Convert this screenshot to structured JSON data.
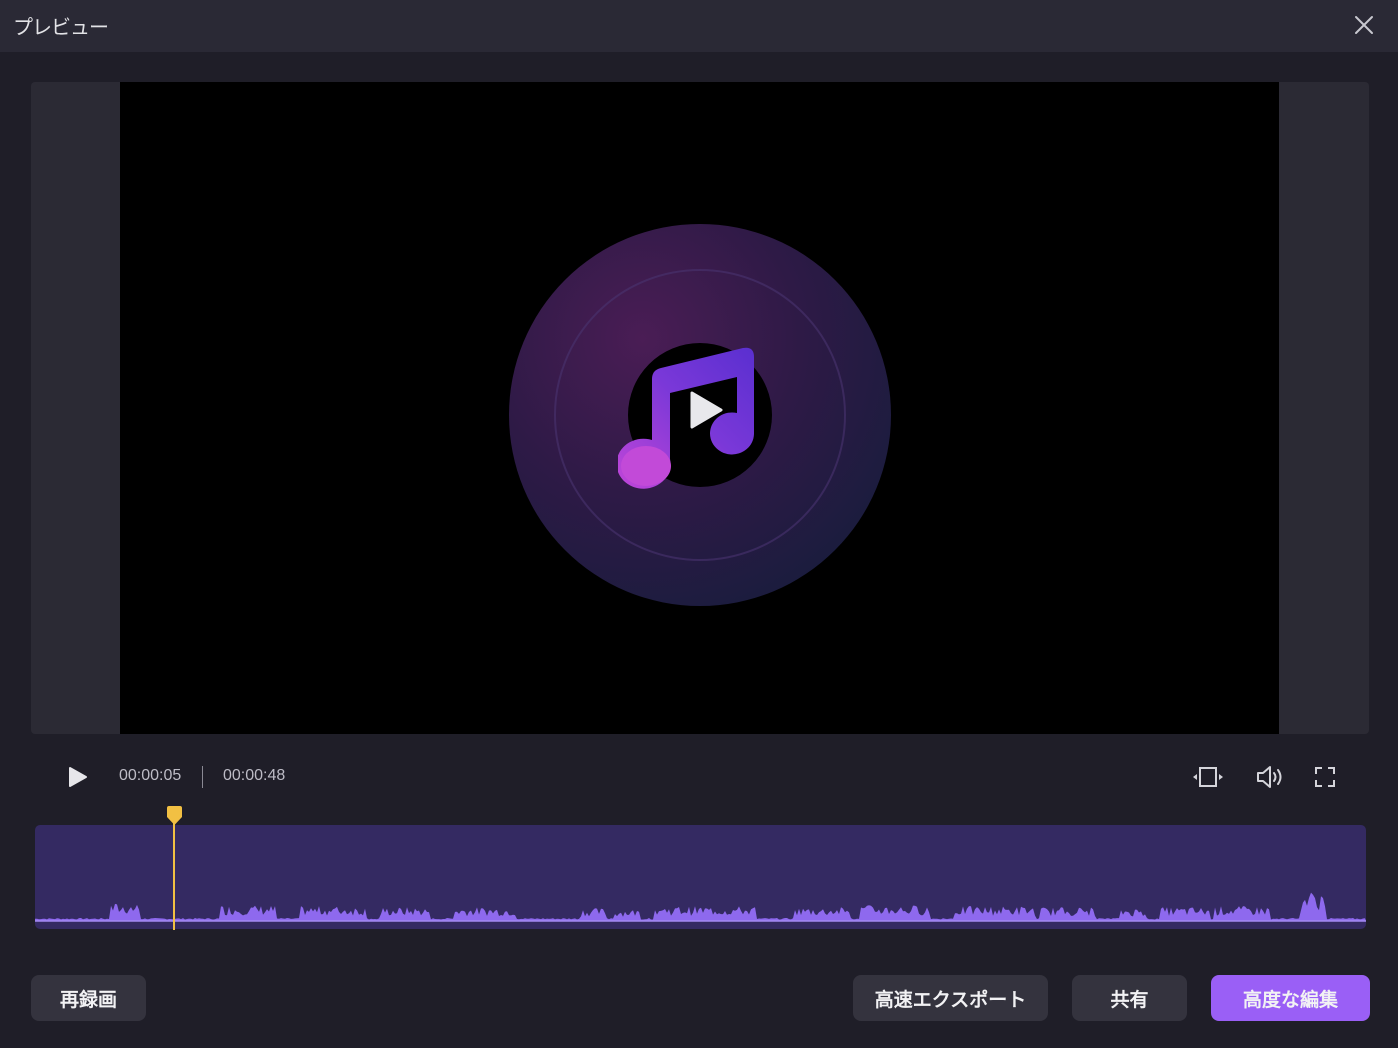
{
  "window": {
    "title": "プレビュー"
  },
  "player": {
    "current_time": "00:00:05",
    "total_time": "00:00:48",
    "progress_fraction": 0.104
  },
  "icons": {
    "close": "close-icon",
    "play": "play-icon",
    "aspect": "aspect-ratio-icon",
    "volume": "volume-icon",
    "fullscreen": "fullscreen-icon",
    "music": "music-note-icon"
  },
  "colors": {
    "accent": "#9a5ff6",
    "playhead": "#f2c043",
    "waveform": "#8e69ee",
    "timeline_bg": "#342a62"
  },
  "actions": {
    "rerecord": "再録画",
    "fast_export": "高速エクスポート",
    "share": "共有",
    "advanced_edit": "高度な編集"
  }
}
